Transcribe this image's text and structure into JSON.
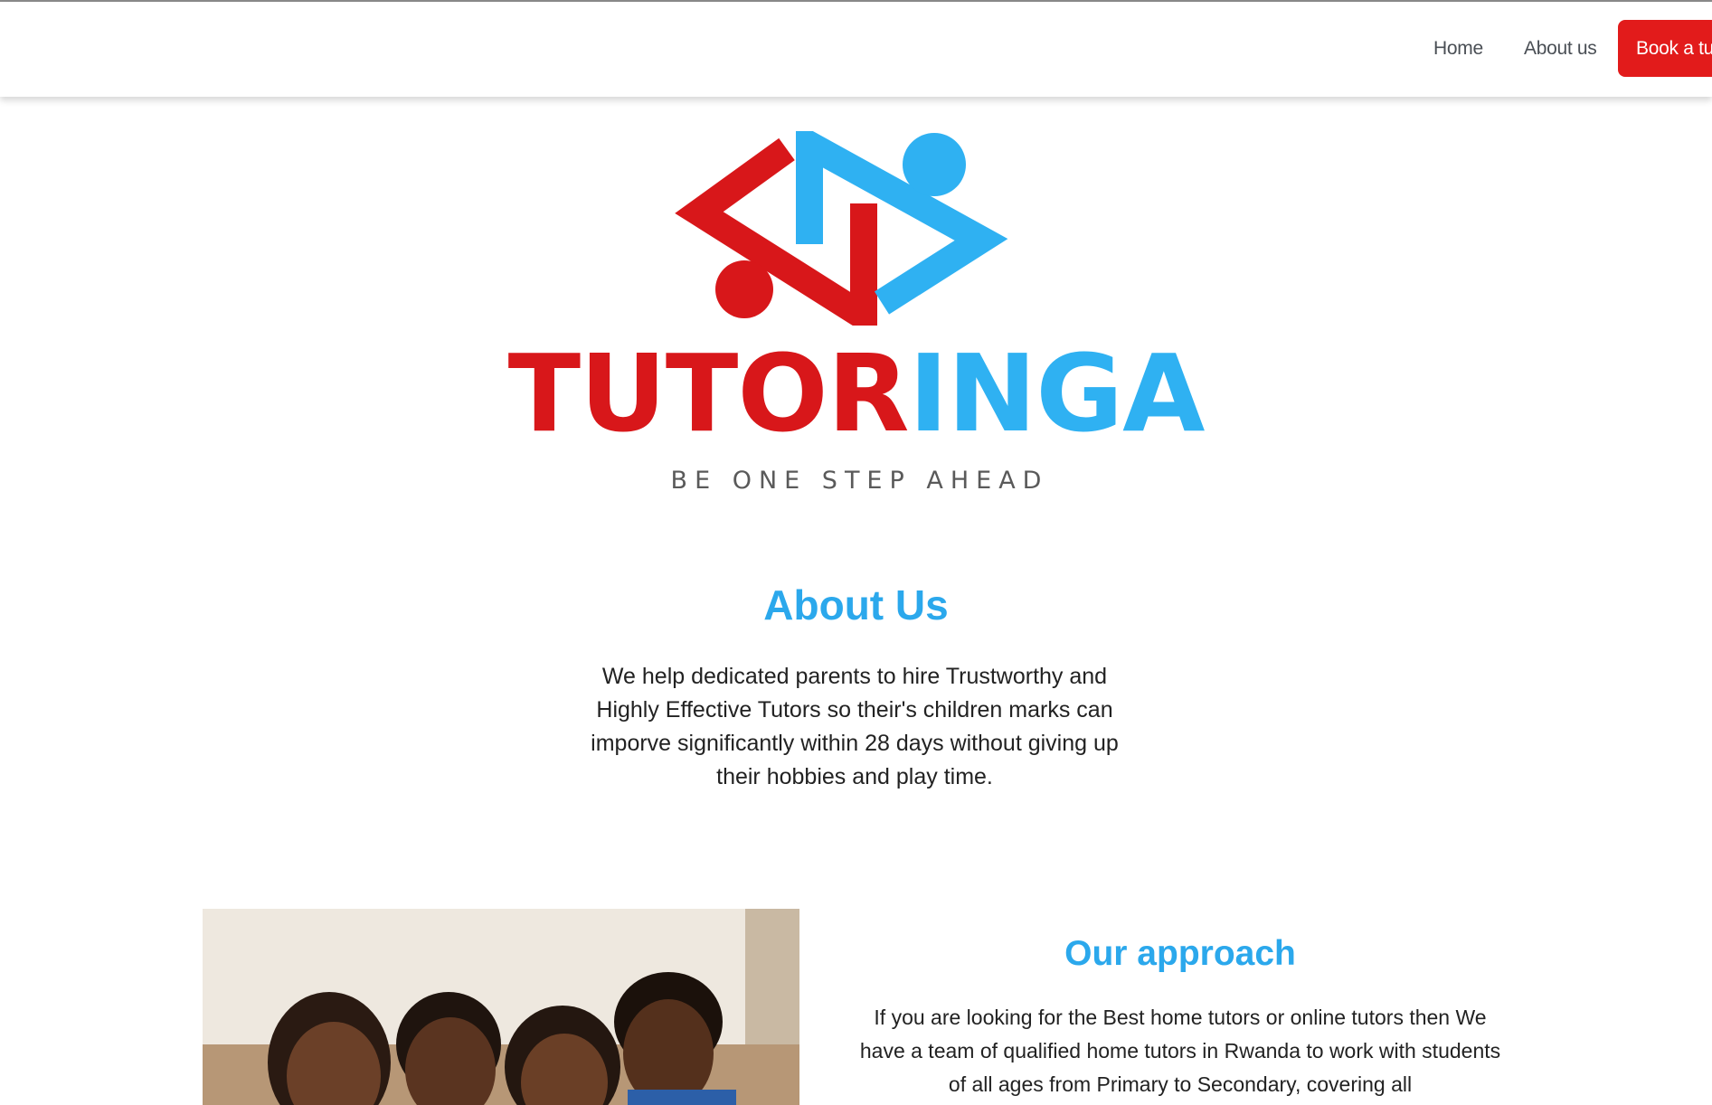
{
  "nav": {
    "home": "Home",
    "about": "About us",
    "cta": "Book a tutor"
  },
  "brand": {
    "word_red": "TUTOR",
    "word_blue": "INGA",
    "tagline": "BE ONE STEP AHEAD",
    "colors": {
      "red": "#d8171a",
      "blue": "#2fb1f2"
    }
  },
  "about": {
    "title": "About Us",
    "text": "We help dedicated parents to hire Trustworthy and Highly Effective Tutors so their's children marks can imporve significantly within 28 days without giving up their hobbies and play time."
  },
  "approach": {
    "title": "Our approach",
    "text": "If you are looking for the Best home tutors or online tutors then We have a team of qualified home tutors in Rwanda to work with students of all ages from Primary to Secondary, covering all"
  },
  "colors": {
    "accent": "#2ba8ec",
    "button": "#e21b1b"
  }
}
